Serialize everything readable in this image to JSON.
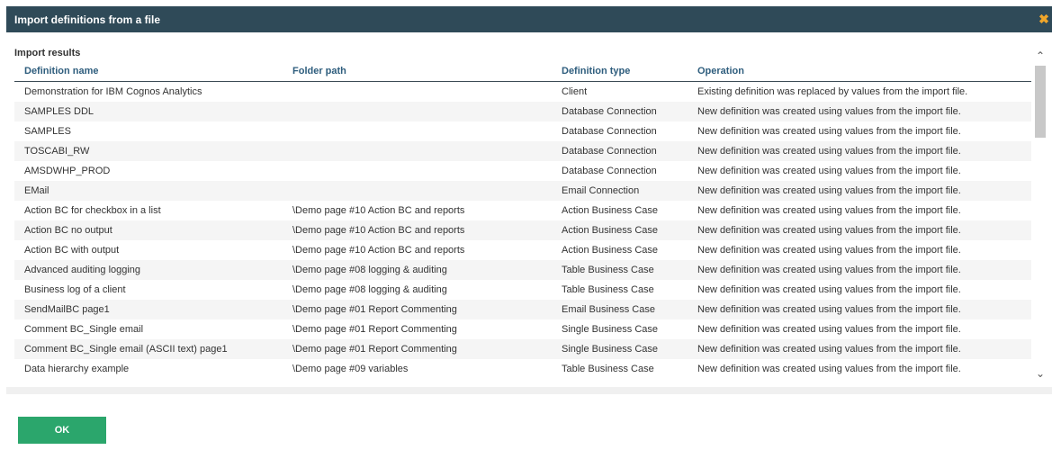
{
  "dialog": {
    "title": "Import definitions from a file",
    "close_icon": "close-icon",
    "results_label": "Import results",
    "ok_label": "OK"
  },
  "colors": {
    "titlebar": "#2f4a58",
    "close_icon": "#f0a62a",
    "header_text": "#2e5d7d",
    "ok_button": "#2ba66c"
  },
  "table": {
    "headers": [
      "Definition name",
      "Folder path",
      "Definition type",
      "Operation"
    ],
    "rows": [
      [
        "Demonstration for IBM Cognos Analytics",
        "",
        "Client",
        "Existing definition was replaced by values from the import file."
      ],
      [
        "SAMPLES DDL",
        "",
        "Database Connection",
        "New definition was created using values from the import file."
      ],
      [
        "SAMPLES",
        "",
        "Database Connection",
        "New definition was created using values from the import file."
      ],
      [
        "TOSCABI_RW",
        "",
        "Database Connection",
        "New definition was created using values from the import file."
      ],
      [
        "AMSDWHP_PROD",
        "",
        "Database Connection",
        "New definition was created using values from the import file."
      ],
      [
        "EMail",
        "",
        "Email Connection",
        "New definition was created using values from the import file."
      ],
      [
        "Action BC for checkbox in a list",
        "\\Demo page #10 Action BC and reports",
        "Action Business Case",
        "New definition was created using values from the import file."
      ],
      [
        "Action BC no output",
        "\\Demo page #10 Action BC and reports",
        "Action Business Case",
        "New definition was created using values from the import file."
      ],
      [
        "Action BC with output",
        "\\Demo page #10 Action BC and reports",
        "Action Business Case",
        "New definition was created using values from the import file."
      ],
      [
        "Advanced auditing logging",
        "\\Demo page #08 logging & auditing",
        "Table Business Case",
        "New definition was created using values from the import file."
      ],
      [
        "Business log of a client",
        "\\Demo page #08 logging & auditing",
        "Table Business Case",
        "New definition was created using values from the import file."
      ],
      [
        "SendMailBC page1",
        "\\Demo page #01 Report Commenting",
        "Email Business Case",
        "New definition was created using values from the import file."
      ],
      [
        "Comment BC_Single email",
        "\\Demo page #01 Report Commenting",
        "Single Business Case",
        "New definition was created using values from the import file."
      ],
      [
        "Comment BC_Single email (ASCII text) page1",
        "\\Demo page #01 Report Commenting",
        "Single Business Case",
        "New definition was created using values from the import file."
      ],
      [
        "Data hierarchy example",
        "\\Demo page #09 variables",
        "Table Business Case",
        "New definition was created using values from the import file."
      ]
    ]
  }
}
